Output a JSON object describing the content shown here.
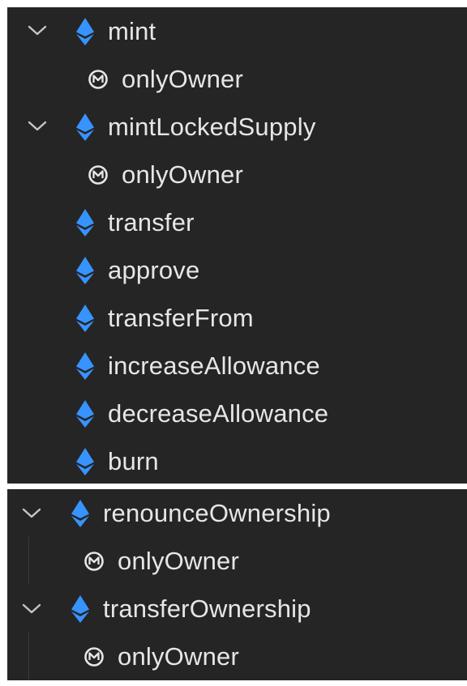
{
  "top_tree": {
    "rows": [
      {
        "label": "mint",
        "icon": "ethereum-icon",
        "expandable": true,
        "expanded": true
      },
      {
        "label": "onlyOwner",
        "icon": "modifier-icon",
        "expandable": false
      },
      {
        "label": "mintLockedSupply",
        "icon": "ethereum-icon",
        "expandable": true,
        "expanded": true
      },
      {
        "label": "onlyOwner",
        "icon": "modifier-icon",
        "expandable": false
      },
      {
        "label": "transfer",
        "icon": "ethereum-icon",
        "expandable": false
      },
      {
        "label": "approve",
        "icon": "ethereum-icon",
        "expandable": false
      },
      {
        "label": "transferFrom",
        "icon": "ethereum-icon",
        "expandable": false
      },
      {
        "label": "increaseAllowance",
        "icon": "ethereum-icon",
        "expandable": false
      },
      {
        "label": "decreaseAllowance",
        "icon": "ethereum-icon",
        "expandable": false
      },
      {
        "label": "burn",
        "icon": "ethereum-icon",
        "expandable": false
      }
    ]
  },
  "bottom_tree": {
    "rows": [
      {
        "label": "renounceOwnership",
        "icon": "ethereum-icon",
        "expandable": true,
        "expanded": true
      },
      {
        "label": "onlyOwner",
        "icon": "modifier-icon",
        "expandable": false
      },
      {
        "label": "transferOwnership",
        "icon": "ethereum-icon",
        "expandable": true,
        "expanded": true
      },
      {
        "label": "onlyOwner",
        "icon": "modifier-icon",
        "expandable": false
      }
    ]
  },
  "colors": {
    "panel_background": "#252526",
    "text": "#e6e6e6",
    "ethereum_icon": "#3794ff",
    "chevron": "#c5c5c5"
  }
}
